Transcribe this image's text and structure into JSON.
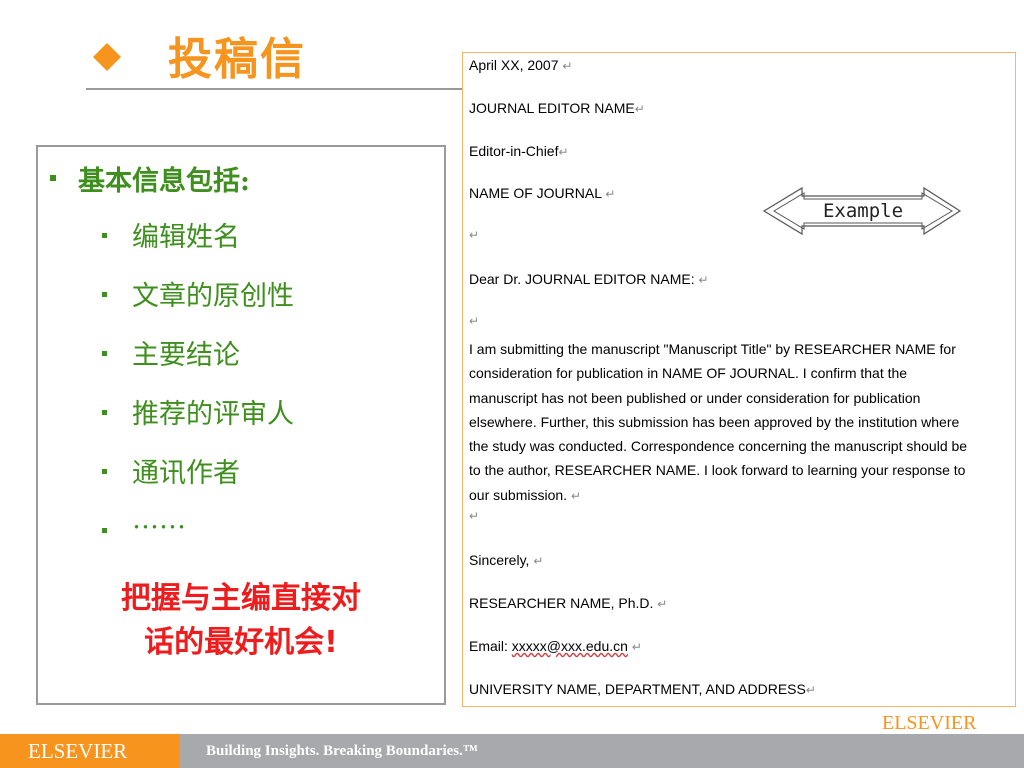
{
  "slide": {
    "title": "投稿信",
    "heading": "基本信息包括:",
    "items": [
      "编辑姓名",
      "文章的原创性",
      "主要结论",
      "推荐的评审人",
      "通讯作者",
      "……"
    ],
    "emphasis_line1": "把握与主编直接对",
    "emphasis_line2_a": "话的",
    "emphasis_line2_b": "最好机会",
    "emphasis_line2_c": "!",
    "example_label": "Example"
  },
  "letter": {
    "date": "April XX, 2007",
    "editor_name": "JOURNAL EDITOR NAME",
    "editor_title": "Editor-in-Chief",
    "journal_name": "NAME OF JOURNAL",
    "salutation": "Dear Dr. JOURNAL EDITOR NAME:",
    "body_lines": [
      "I am submitting the manuscript \"Manuscript Title\" by RESEARCHER NAME for",
      "consideration for publication in NAME OF JOURNAL. I confirm that the",
      "manuscript has not been published or under consideration for publication",
      "elsewhere. Further, this submission has been approved by the institution where",
      "the study was conducted. Correspondence concerning the manuscript should be",
      "to the author, RESEARCHER NAME. I look forward to learning your response to",
      "our submission."
    ],
    "closing": "Sincerely,",
    "signature": "RESEARCHER NAME, Ph.D.",
    "email_label": "Email: ",
    "email_value": "xxxxx@xxx.edu.cn",
    "address": "UNIVERSITY NAME, DEPARTMENT, AND ADDRESS",
    "return_mark": "↵"
  },
  "footer": {
    "brand": "ELSEVIER",
    "slogan": "Building Insights. Breaking Boundaries.™",
    "brand_right": "ELSEVIER"
  },
  "colors": {
    "orange": "#f7941d",
    "green": "#3e8f1e",
    "red": "#ee1c1c",
    "gray": "#a7a9ac"
  }
}
